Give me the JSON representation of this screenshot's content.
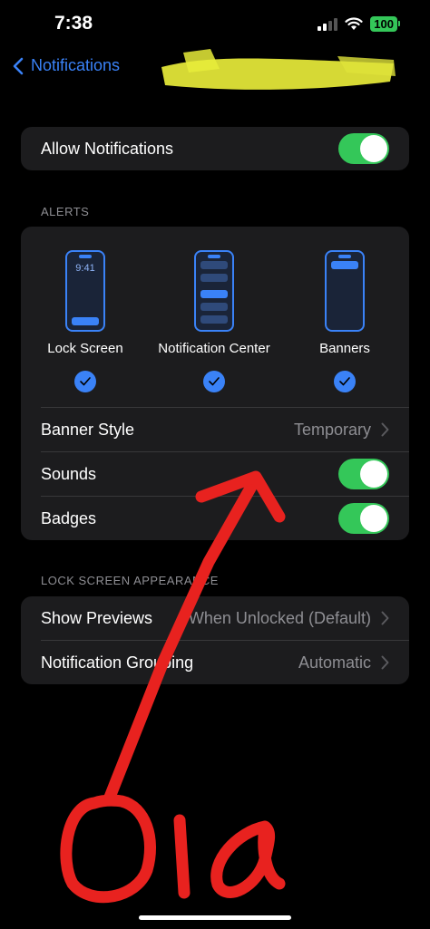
{
  "status_bar": {
    "time": "7:38",
    "battery": "100",
    "signal_icon": "cellular-signal-icon",
    "wifi_icon": "wifi-icon"
  },
  "nav": {
    "back_label": "Notifications",
    "back_icon": "chevron-left-icon"
  },
  "allow_notifications": {
    "label": "Allow Notifications",
    "on": true
  },
  "alerts": {
    "header": "ALERTS",
    "previews": [
      {
        "label": "Lock Screen",
        "phone_text": "9:41",
        "checked": true
      },
      {
        "label": "Notification Center",
        "checked": true
      },
      {
        "label": "Banners",
        "checked": true
      }
    ],
    "banner_style": {
      "label": "Banner Style",
      "value": "Temporary"
    },
    "sounds": {
      "label": "Sounds",
      "on": true
    },
    "badges": {
      "label": "Badges",
      "on": true
    }
  },
  "lock_screen_appearance": {
    "header": "LOCK SCREEN APPEARANCE",
    "show_previews": {
      "label": "Show Previews",
      "value": "When Unlocked (Default)"
    },
    "notification_grouping": {
      "label": "Notification Grouping",
      "value": "Automatic"
    }
  },
  "colors": {
    "accent": "#3a82f7",
    "toggle_on": "#34c759",
    "card_bg": "#1c1c1e",
    "annotation_red": "#e8221f",
    "redaction_yellow": "#e8ec3a"
  },
  "annotation": {
    "handwritten_text": "Ola"
  }
}
